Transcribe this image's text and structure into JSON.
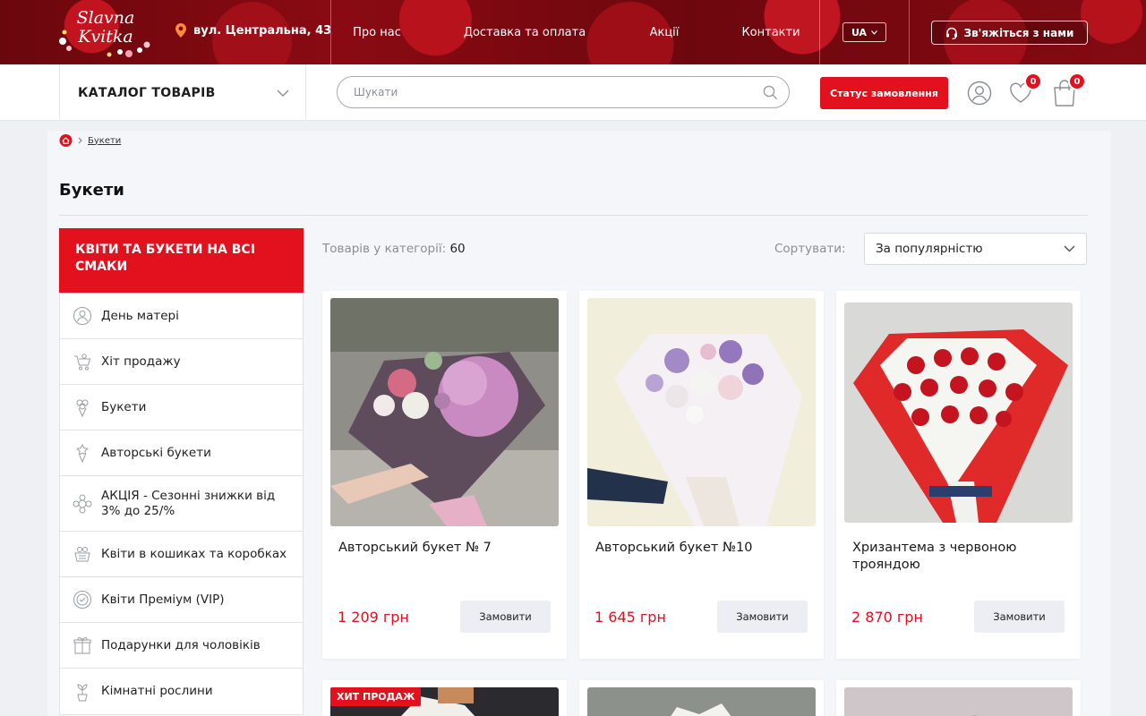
{
  "header": {
    "logo_text": "Slavna Kvitka",
    "address": "вул. Центральна, 43",
    "nav": [
      "Про нас",
      "Доставка та оплата",
      "Акції",
      "Контакти"
    ],
    "language": "UA",
    "contact_label": "Зв'яжіться з нами"
  },
  "subbar": {
    "catalog_label": "КАТАЛОГ ТОВАРІВ",
    "search_placeholder": "Шукати",
    "status_label": "Статус замовлення",
    "wishlist_count": "0",
    "cart_count": "0"
  },
  "breadcrumb": {
    "current": "Букети"
  },
  "page_title": "Букети",
  "sidebar": {
    "heading": "КВІТИ ТА БУКЕТИ НА ВСІ СМАКИ",
    "items": [
      {
        "label": "День матері",
        "icon": "mother-day-icon"
      },
      {
        "label": "Хіт продажу",
        "icon": "cart-flower-icon"
      },
      {
        "label": "Букети",
        "icon": "bouquet-icon"
      },
      {
        "label": "Авторські букети",
        "icon": "author-bouquet-icon"
      },
      {
        "label": "АКЦІЯ - Сезонні знижки від 3% до 25/%",
        "icon": "discount-flower-icon"
      },
      {
        "label": "Квіти в кошиках та коробках",
        "icon": "basket-icon"
      },
      {
        "label": "Квіти Преміум (VIP)",
        "icon": "premium-icon"
      },
      {
        "label": "Подарунки для чоловіків",
        "icon": "gift-icon"
      },
      {
        "label": "Кімнатні рослини",
        "icon": "plant-icon"
      }
    ]
  },
  "toolbar": {
    "count_label": "Товарів у категорії:",
    "count_value": "60",
    "sort_label": "Сортувати:",
    "sort_value": "За популярністю"
  },
  "products": [
    {
      "name": "Авторський букет № 7",
      "price": "1 209 грн",
      "order": "Замовити"
    },
    {
      "name": "Авторський букет №10",
      "price": "1 645 грн",
      "order": "Замовити"
    },
    {
      "name": "Хризантема з червоною трояндою",
      "price": "2 870 грн",
      "order": "Замовити"
    }
  ],
  "hit_badge": "ХИТ ПРОДАЖ",
  "colors": {
    "accent": "#e3101e",
    "background": "#eef0f4"
  }
}
